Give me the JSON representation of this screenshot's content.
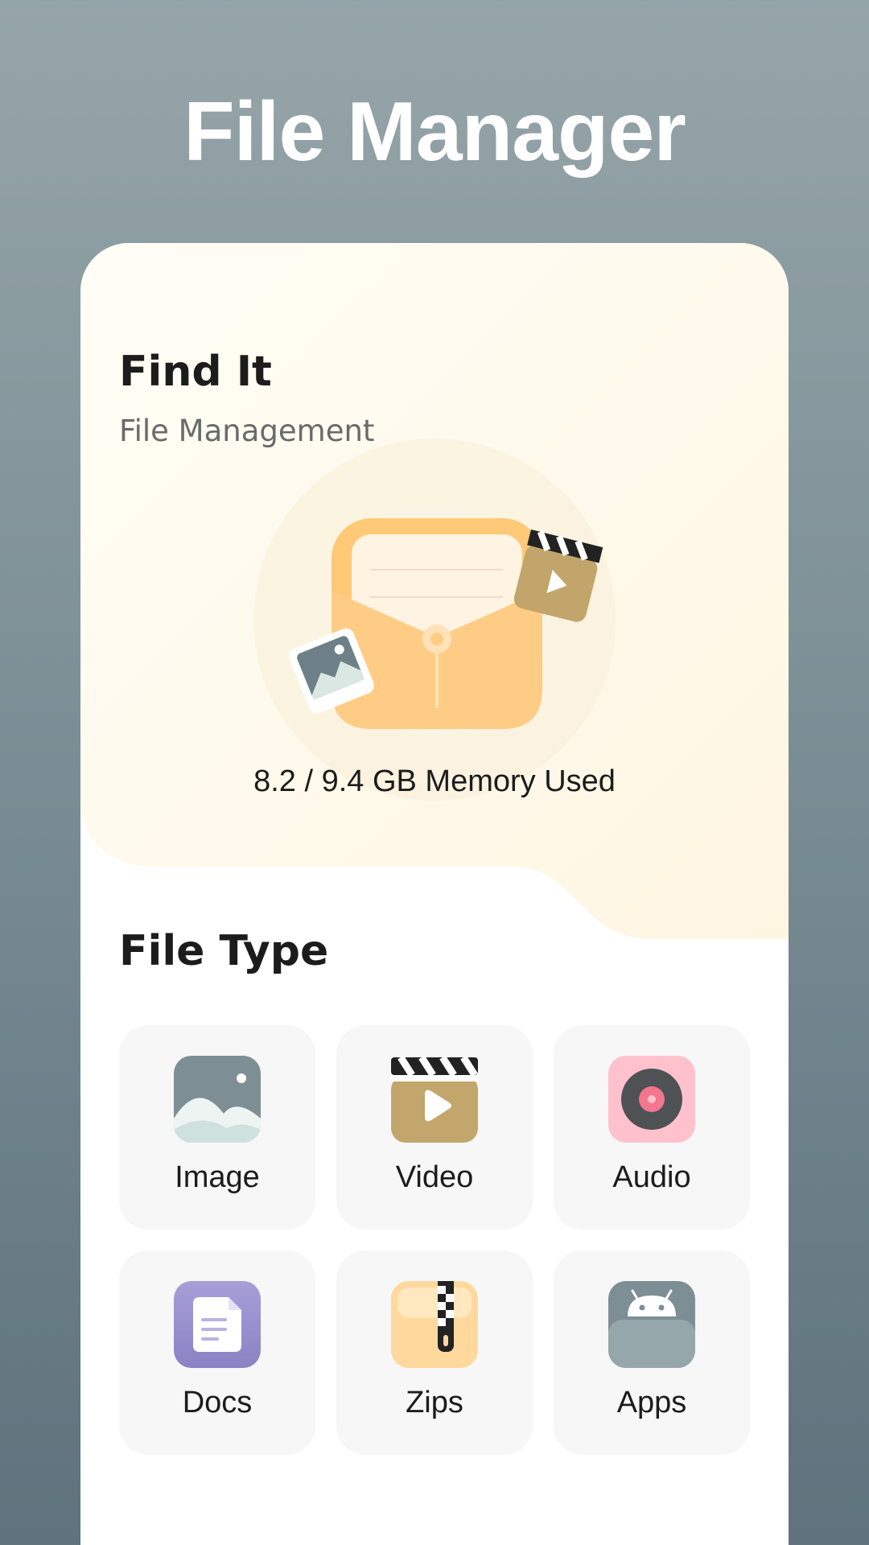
{
  "app": {
    "title": "File Manager"
  },
  "hero": {
    "title": "Find It",
    "subtitle": "File Management",
    "memory_text": "8.2 / 9.4 GB Memory Used"
  },
  "file_types": {
    "title": "File Type",
    "items": [
      {
        "label": "Image",
        "icon": "image-icon"
      },
      {
        "label": "Video",
        "icon": "video-icon"
      },
      {
        "label": "Audio",
        "icon": "audio-icon"
      },
      {
        "label": "Docs",
        "icon": "docs-icon"
      },
      {
        "label": "Zips",
        "icon": "zips-icon"
      },
      {
        "label": "Apps",
        "icon": "apps-icon"
      }
    ]
  },
  "colors": {
    "background_top": "#96a5a9",
    "background_bottom": "#5f727d",
    "hero_cream": "#fffbee",
    "folder_orange": "#ffc978",
    "tile_bg": "#f7f7f7"
  }
}
